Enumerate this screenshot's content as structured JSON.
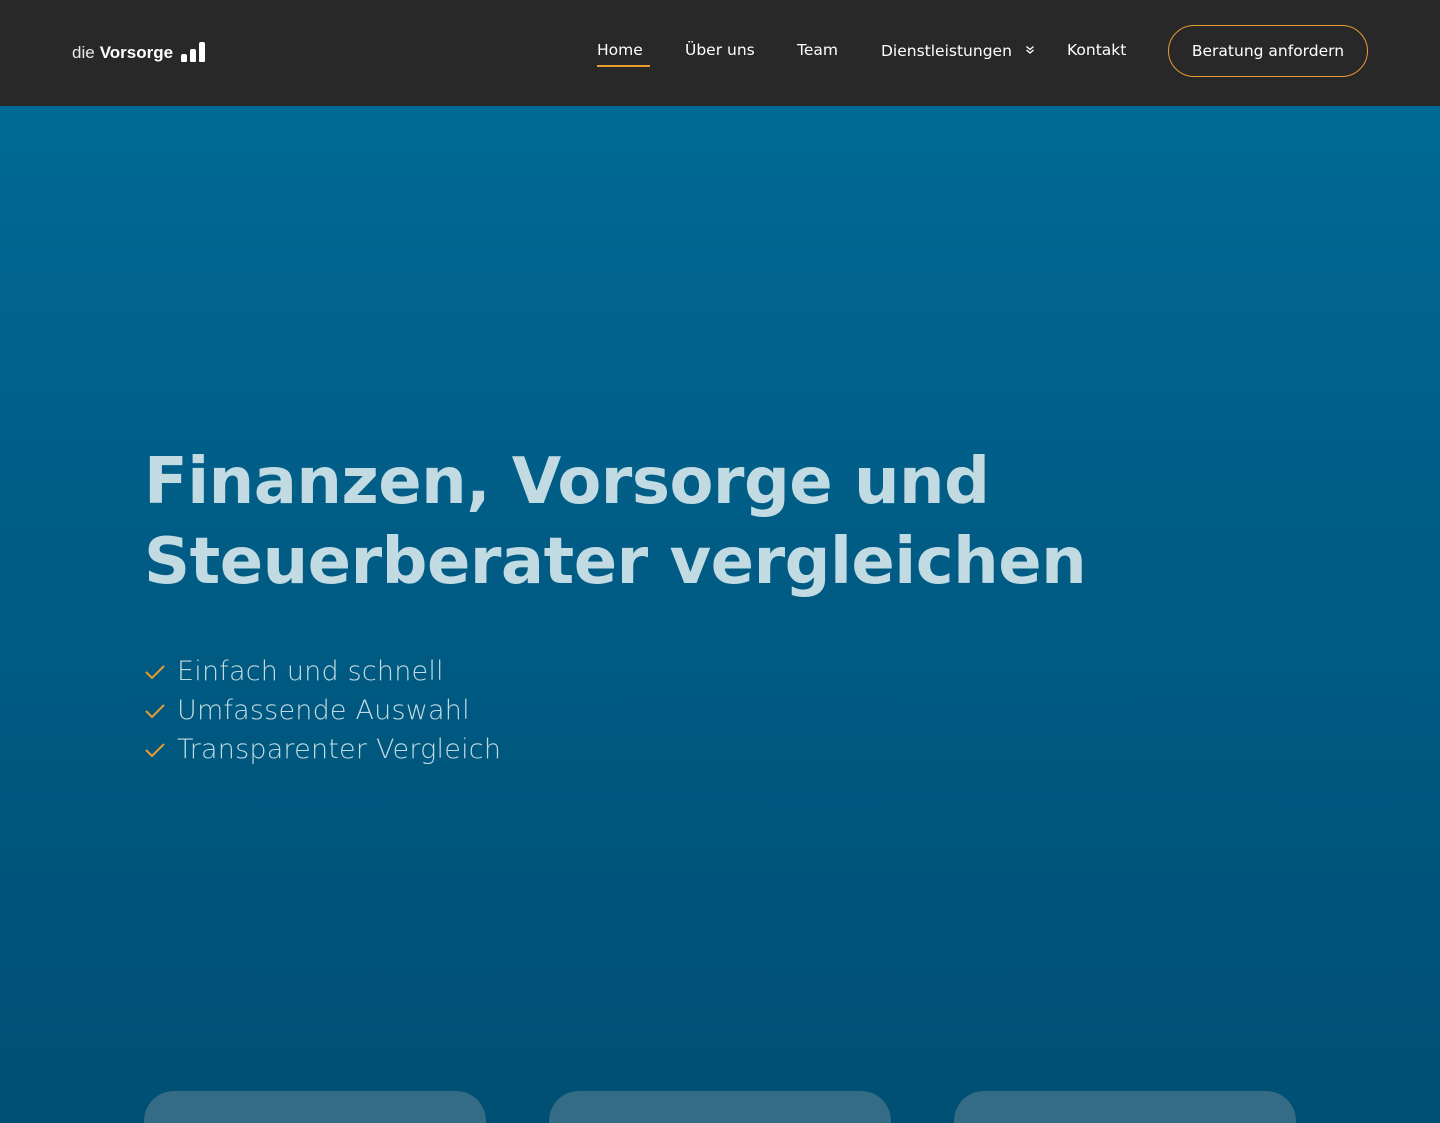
{
  "header": {
    "logo": {
      "prefix": "die",
      "name": "Vorsorge",
      "icon": "bar-chart-icon"
    },
    "nav": {
      "items": [
        {
          "label": "Home",
          "active": true
        },
        {
          "label": "Über uns",
          "active": false
        },
        {
          "label": "Team",
          "active": false
        },
        {
          "label": "Dienstleistungen",
          "active": false,
          "icon": "chevron-double-down-icon"
        },
        {
          "label": "Kontakt",
          "active": false
        }
      ]
    },
    "cta": {
      "label": "Beratung anfordern"
    }
  },
  "hero": {
    "title_line1": "Finanzen, Vorsorge und",
    "title_line2": "Steuerberater vergleichen",
    "features": [
      {
        "label": "Einfach und schnell",
        "icon": "check-icon"
      },
      {
        "label": "Umfassende Auswahl",
        "icon": "check-icon"
      },
      {
        "label": "Transparenter Vergleich",
        "icon": "check-icon"
      }
    ]
  },
  "colors": {
    "header_bg": "#282828",
    "accent": "#e89b2f",
    "hero_top": "#006a96",
    "hero_bottom": "#004f74",
    "hero_text": "#c2dbe2",
    "card_bg": "#346b85"
  }
}
